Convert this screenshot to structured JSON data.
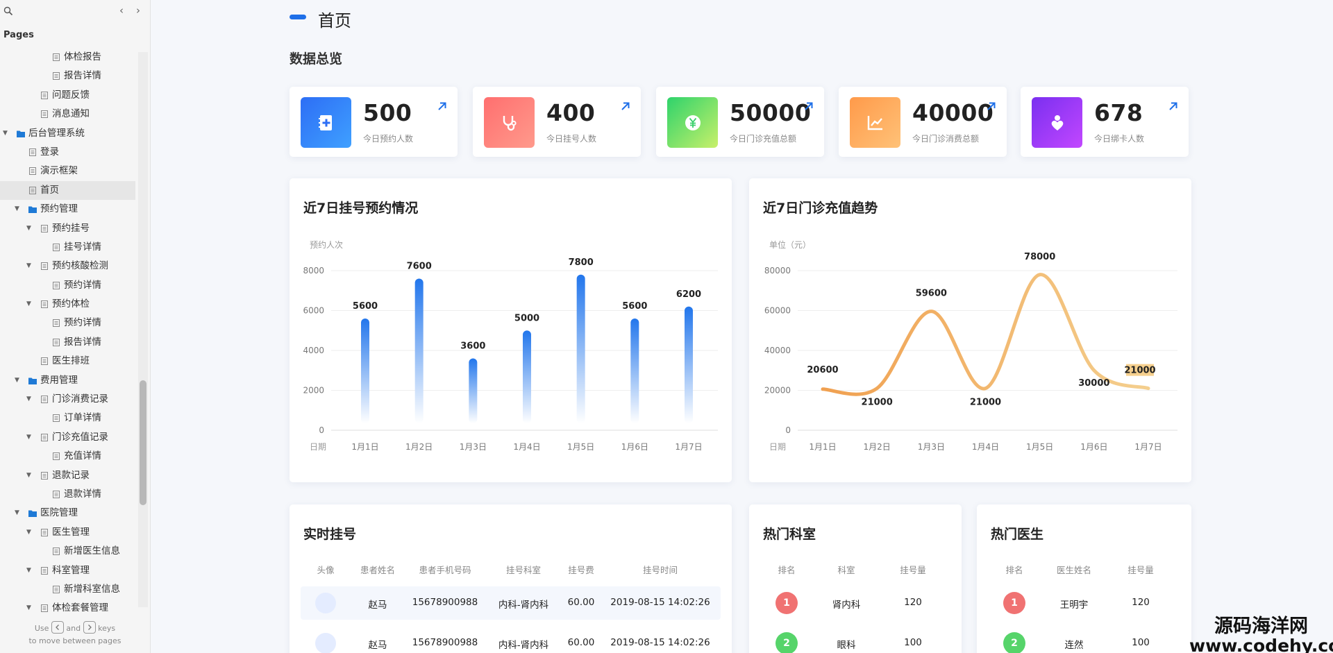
{
  "sidebar": {
    "pages_label": "Pages",
    "prev_label": "‹",
    "next_label": "›",
    "items": [
      {
        "label": "体检报告",
        "depth": 3,
        "type": "page",
        "expanded": false
      },
      {
        "label": "报告详情",
        "depth": 3,
        "type": "page",
        "expanded": false
      },
      {
        "label": "问题反馈",
        "depth": 2,
        "type": "page",
        "expanded": false
      },
      {
        "label": "消息通知",
        "depth": 2,
        "type": "page",
        "expanded": false
      },
      {
        "label": "后台管理系统",
        "depth": 0,
        "type": "folder",
        "expanded": true
      },
      {
        "label": "登录",
        "depth": 1,
        "type": "page",
        "expanded": false
      },
      {
        "label": "演示框架",
        "depth": 1,
        "type": "page",
        "expanded": false
      },
      {
        "label": "首页",
        "depth": 1,
        "type": "page",
        "expanded": false,
        "active": true
      },
      {
        "label": "预约管理",
        "depth": 1,
        "type": "folder",
        "expanded": true
      },
      {
        "label": "预约挂号",
        "depth": 2,
        "type": "page",
        "expanded": true
      },
      {
        "label": "挂号详情",
        "depth": 3,
        "type": "page",
        "expanded": false
      },
      {
        "label": "预约核酸检测",
        "depth": 2,
        "type": "page",
        "expanded": true
      },
      {
        "label": "预约详情",
        "depth": 3,
        "type": "page",
        "expanded": false
      },
      {
        "label": "预约体检",
        "depth": 2,
        "type": "page",
        "expanded": true
      },
      {
        "label": "预约详情",
        "depth": 3,
        "type": "page",
        "expanded": false
      },
      {
        "label": "报告详情",
        "depth": 3,
        "type": "page",
        "expanded": false
      },
      {
        "label": "医生排班",
        "depth": 2,
        "type": "page",
        "expanded": false
      },
      {
        "label": "费用管理",
        "depth": 1,
        "type": "folder",
        "expanded": true
      },
      {
        "label": "门诊消费记录",
        "depth": 2,
        "type": "page",
        "expanded": true
      },
      {
        "label": "订单详情",
        "depth": 3,
        "type": "page",
        "expanded": false
      },
      {
        "label": "门诊充值记录",
        "depth": 2,
        "type": "page",
        "expanded": true
      },
      {
        "label": "充值详情",
        "depth": 3,
        "type": "page",
        "expanded": false
      },
      {
        "label": "退款记录",
        "depth": 2,
        "type": "page",
        "expanded": true
      },
      {
        "label": "退款详情",
        "depth": 3,
        "type": "page",
        "expanded": false
      },
      {
        "label": "医院管理",
        "depth": 1,
        "type": "folder",
        "expanded": true
      },
      {
        "label": "医生管理",
        "depth": 2,
        "type": "page",
        "expanded": true
      },
      {
        "label": "新增医生信息",
        "depth": 3,
        "type": "page",
        "expanded": false
      },
      {
        "label": "科室管理",
        "depth": 2,
        "type": "page",
        "expanded": true
      },
      {
        "label": "新增科室信息",
        "depth": 3,
        "type": "page",
        "expanded": false
      },
      {
        "label": "体检套餐管理",
        "depth": 2,
        "type": "page",
        "expanded": true
      }
    ],
    "hint_use": "Use",
    "hint_and": "and",
    "hint_keys": "keys",
    "hint_line2": "to move between pages"
  },
  "page": {
    "title": "首页",
    "section_title": "数据总览"
  },
  "stats": [
    {
      "value": "500",
      "label": "今日预约人数",
      "icon": "notebook-plus-icon",
      "color_from": "#2d6ef5",
      "color_to": "#3fa0ff"
    },
    {
      "value": "400",
      "label": "今日挂号人数",
      "icon": "stethoscope-icon",
      "color_from": "#ff6f6f",
      "color_to": "#ff9a8c"
    },
    {
      "value": "50000",
      "label": "今日门诊充值总额",
      "icon": "yuan-coin-icon",
      "color_from": "#2ed36b",
      "color_to": "#c8f06a"
    },
    {
      "value": "40000",
      "label": "今日门诊消费总额",
      "icon": "trend-chart-icon",
      "color_from": "#ff9a4a",
      "color_to": "#ffc278"
    },
    {
      "value": "678",
      "label": "今日绑卡人数",
      "icon": "heart-hand-icon",
      "color_from": "#7a2ff0",
      "color_to": "#c247ff"
    }
  ],
  "colors": {
    "accent": "#1e6fe8",
    "arrow": "#1e6fe8",
    "bar_top": "#2276ec",
    "line_from": "#f0a050",
    "line_to": "#f4cf8e",
    "rank_red": "#f07272",
    "rank_green": "#56d46a"
  },
  "chart_data": [
    {
      "type": "bar",
      "title": "近7日挂号预约情况",
      "ylabel": "预约人次",
      "xlabel": "日期",
      "categories": [
        "1月1日",
        "1月2日",
        "1月3日",
        "1月4日",
        "1月5日",
        "1月6日",
        "1月7日"
      ],
      "values": [
        5600,
        7600,
        3600,
        5000,
        7800,
        5600,
        6200
      ],
      "ylim": [
        0,
        8000
      ],
      "yticks": [
        0,
        2000,
        4000,
        6000,
        8000
      ],
      "grid": true
    },
    {
      "type": "line",
      "title": "近7日门诊充值趋势",
      "ylabel": "单位（元）",
      "xlabel": "日期",
      "categories": [
        "1月1日",
        "1月2日",
        "1月3日",
        "1月4日",
        "1月5日",
        "1月6日",
        "1月7日"
      ],
      "values": [
        20600,
        21000,
        59600,
        21000,
        78000,
        30000,
        21000
      ],
      "ylim": [
        0,
        80000
      ],
      "yticks": [
        0,
        20000,
        40000,
        60000,
        80000
      ],
      "grid": true,
      "smooth": true
    }
  ],
  "realtime": {
    "title": "实时挂号",
    "columns": [
      "头像",
      "患者姓名",
      "患者手机号码",
      "挂号科室",
      "挂号费",
      "挂号时间"
    ],
    "rows": [
      [
        "赵马",
        "15678900988",
        "内科-肾内科",
        "60.00",
        "2019-08-15 14:02:26"
      ],
      [
        "赵马",
        "15678900988",
        "内科-肾内科",
        "60.00",
        "2019-08-15 14:02:26"
      ]
    ]
  },
  "departments": {
    "title": "热门科室",
    "columns": [
      "排名",
      "科室",
      "挂号量"
    ],
    "rows": [
      [
        "1",
        "肾内科",
        "120"
      ],
      [
        "2",
        "眼科",
        "100"
      ]
    ]
  },
  "doctors": {
    "title": "热门医生",
    "columns": [
      "排名",
      "医生姓名",
      "挂号量"
    ],
    "rows": [
      [
        "1",
        "王明宇",
        "120"
      ],
      [
        "2",
        "连然",
        "100"
      ]
    ]
  },
  "watermark": {
    "line1": "源码海洋网",
    "line2": "www.codehy.com"
  }
}
